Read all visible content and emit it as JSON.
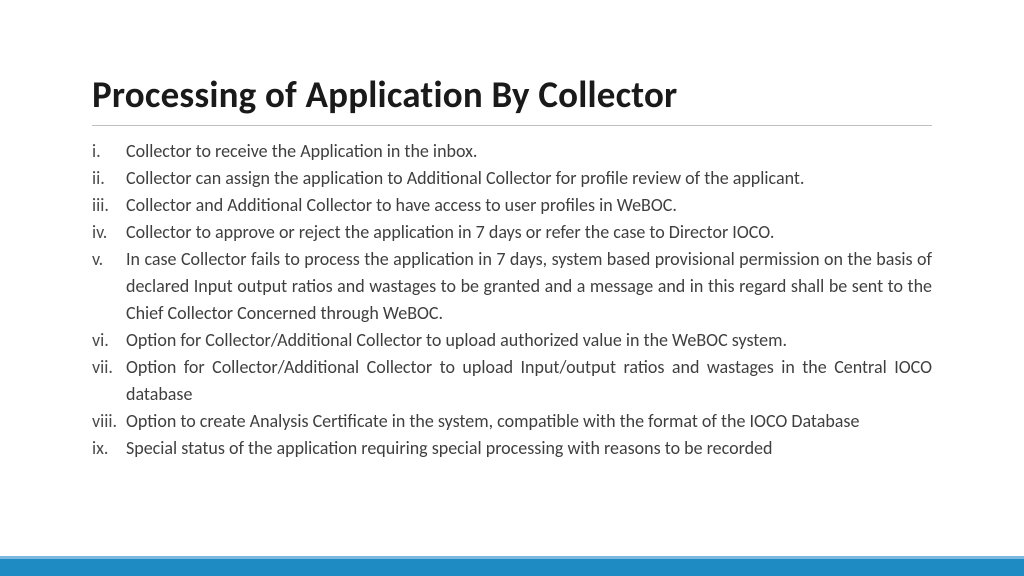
{
  "title": "Processing of Application By Collector",
  "items": [
    {
      "marker": "i.",
      "text": "Collector to receive the Application in the inbox.",
      "justify": false
    },
    {
      "marker": "ii.",
      "text": "Collector can assign the application to Additional Collector for profile review of the applicant.",
      "justify": false
    },
    {
      "marker": "iii.",
      "text": "Collector and Additional Collector to have access to user profiles in WeBOC.",
      "justify": false
    },
    {
      "marker": "iv.",
      "text": "Collector to approve or reject the application in 7 days or refer the case to Director IOCO.",
      "justify": false
    },
    {
      "marker": "v.",
      "text": "In case Collector fails to process the application in 7 days, system based provisional permission on the basis of declared Input output ratios and wastages to be granted and a message and in this regard shall be sent to the Chief Collector Concerned through WeBOC.",
      "justify": true
    },
    {
      "marker": "vi.",
      "text": "Option for Collector/Additional Collector to upload authorized value in the WeBOC system.",
      "justify": false
    },
    {
      "marker": "vii.",
      "text": "Option for Collector/Additional Collector to upload Input/output ratios and wastages in the Central IOCO database",
      "justify": true
    },
    {
      "marker": "viii.",
      "text": "Option to create Analysis Certificate in the system, compatible with the format of the IOCO Database",
      "justify": true
    },
    {
      "marker": "ix.",
      "text": "Special status of the application requiring special processing with reasons to be recorded",
      "justify": false
    }
  ]
}
